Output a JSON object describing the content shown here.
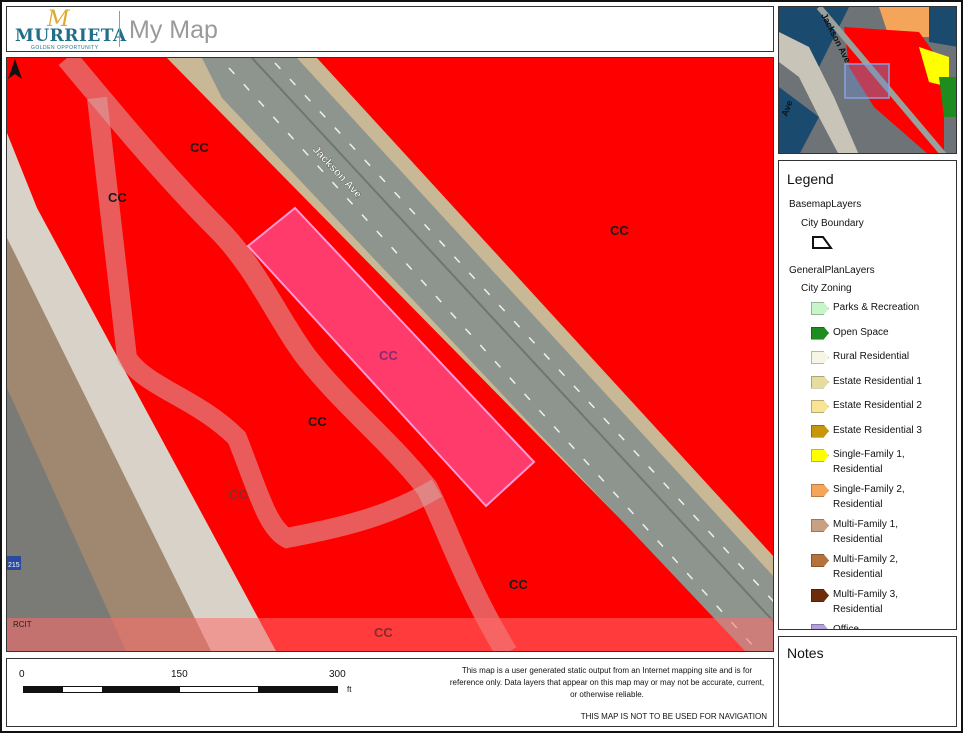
{
  "header": {
    "logo_mark": "M",
    "logo_word": "MURRIETA",
    "logo_tagline": "GOLDEN OPPORTUNITY",
    "title": "My Map"
  },
  "map": {
    "street_label": "Jackson Ave",
    "zone_labels": [
      "CC",
      "CC",
      "CC",
      "CC",
      "CC",
      "CC",
      "CC",
      "CC"
    ],
    "credit": "RCIT",
    "highway_shield": "215",
    "colors": {
      "zoning_commercial": "#ff0000",
      "selected_parcel": "#ff3b6b",
      "roadway": "#8c938c",
      "shoulder": "#c8b79a"
    }
  },
  "overview": {
    "street_label": "Jackson Ave",
    "other_label": "Ave"
  },
  "legend": {
    "title": "Legend",
    "groups": [
      {
        "name": "BasemapLayers",
        "layer": "City Boundary"
      },
      {
        "name": "GeneralPlanLayers",
        "layer": "City Zoning"
      }
    ],
    "items": [
      {
        "line1": "Parks & Recreation",
        "line2": "",
        "color": "#c8f5c8"
      },
      {
        "line1": "Open Space",
        "line2": "",
        "color": "#1e8c1e"
      },
      {
        "line1": "Rural Residential",
        "line2": "",
        "color": "#f7f5e6"
      },
      {
        "line1": "Estate Residential 1",
        "line2": "",
        "color": "#e6dca0"
      },
      {
        "line1": "Estate Residential 2",
        "line2": "",
        "color": "#f7e496"
      },
      {
        "line1": "Estate Residential 3",
        "line2": "",
        "color": "#c8960a"
      },
      {
        "line1": "Single-Family 1,",
        "line2": "Residential",
        "color": "#ffff00"
      },
      {
        "line1": "Single-Family 2,",
        "line2": "Residential",
        "color": "#f5a55a"
      },
      {
        "line1": "Multi-Family 1,",
        "line2": "Residential",
        "color": "#c8a082"
      },
      {
        "line1": "Multi-Family 2,",
        "line2": "Residential",
        "color": "#b4733c"
      },
      {
        "line1": "Multi-Family 3,",
        "line2": "Residential",
        "color": "#6e2d0a"
      },
      {
        "line1": "Office",
        "line2": "",
        "color": "#b4a0dc"
      }
    ]
  },
  "notes": {
    "title": "Notes"
  },
  "footer": {
    "scale_labels": [
      "0",
      "150",
      "300"
    ],
    "scale_unit": "ft",
    "disclaimer": "This map is a user generated static output from an Internet mapping site and is for reference only. Data layers that appear on this map may or may not be accurate, current, or otherwise reliable.",
    "nav_warning": "THIS MAP IS NOT TO BE USED FOR NAVIGATION"
  }
}
